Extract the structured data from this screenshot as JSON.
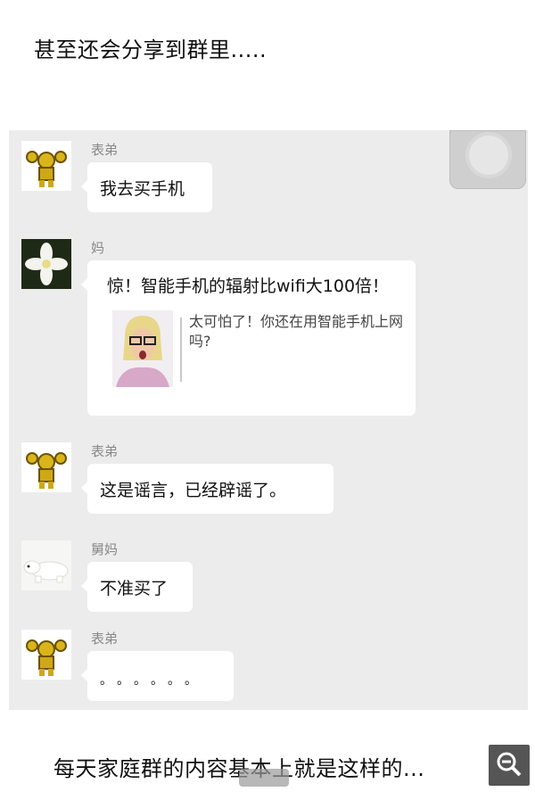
{
  "top_caption": "甚至还会分享到群里.....",
  "bottom_caption": "每天家庭群的内容基本上就是这样的...",
  "messages": [
    {
      "sender": "表弟",
      "text": "我去买手机",
      "avatar": "golden-robot-avatar"
    },
    {
      "sender": "妈",
      "card_title": "惊！智能手机的辐射比wifi大100倍！",
      "card_desc": "太可怕了！你还在用智能手机上网吗?",
      "avatar": "white-flower-avatar"
    },
    {
      "sender": "表弟",
      "text": "这是谣言，已经辟谣了。",
      "avatar": "golden-robot-avatar"
    },
    {
      "sender": "舅妈",
      "text": "不准买了",
      "avatar": "polar-bear-avatar"
    },
    {
      "sender": "表弟",
      "text": "。。。。。。",
      "avatar": "golden-robot-avatar"
    }
  ],
  "colors": {
    "panel_bg": "#ececec",
    "bubble_bg": "#ffffff",
    "sender_text": "#888888"
  }
}
